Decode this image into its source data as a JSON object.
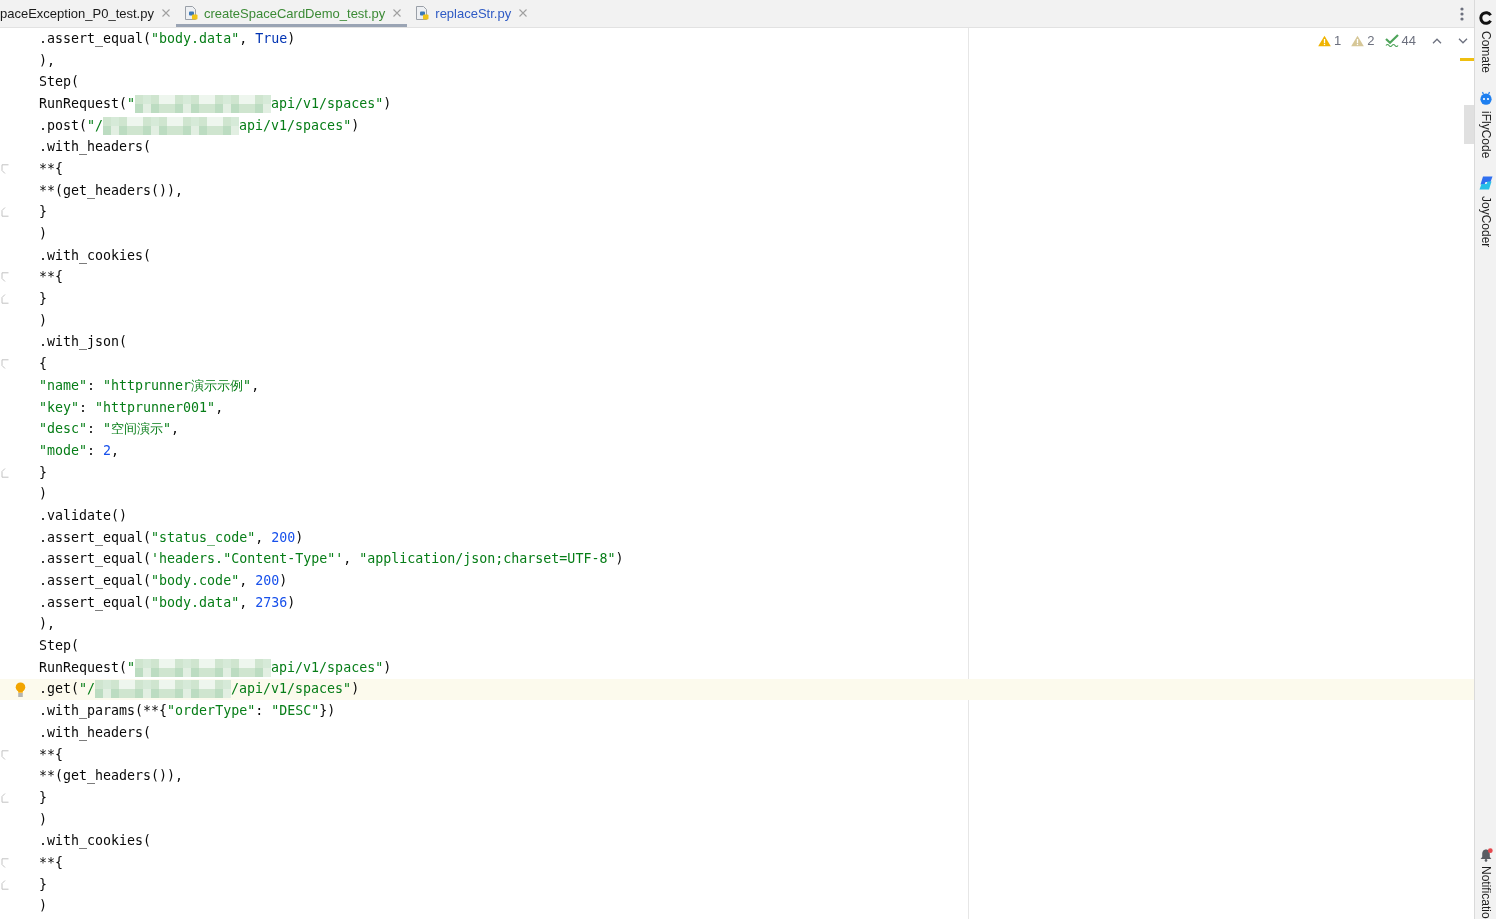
{
  "tabs": [
    {
      "label": "paceException_P0_test.py",
      "icon": false,
      "selected": false,
      "color": "#1a1a1a"
    },
    {
      "label": "createSpaceCardDemo_test.py",
      "icon": true,
      "selected": true,
      "color": "#3b8a35"
    },
    {
      "label": "replaceStr.py",
      "icon": true,
      "selected": false,
      "color": "#2e5ac4"
    }
  ],
  "editor": {
    "inspections": [
      {
        "kind": "warning",
        "count": "1"
      },
      {
        "kind": "weak_warning",
        "count": "2"
      },
      {
        "kind": "typo",
        "count": "44"
      }
    ],
    "code_lines": [
      {
        "current": false,
        "tokens": [
          {
            "kind": "plain",
            "text": "        .assert_equal("
          },
          {
            "kind": "string",
            "text": "\"body.data\""
          },
          {
            "kind": "plain",
            "text": ", "
          },
          {
            "kind": "keyword",
            "text": "True"
          },
          {
            "kind": "plain",
            "text": ")"
          }
        ]
      },
      {
        "current": false,
        "tokens": [
          {
            "kind": "plain",
            "text": "    ),"
          }
        ]
      },
      {
        "current": false,
        "tokens": [
          {
            "kind": "plain",
            "text": "    Step("
          }
        ]
      },
      {
        "current": false,
        "tokens": [
          {
            "kind": "plain",
            "text": "        RunRequest("
          },
          {
            "kind": "string",
            "text": "\""
          },
          {
            "kind": "redacted"
          },
          {
            "kind": "string",
            "text": "api/v1/spaces\""
          },
          {
            "kind": "plain",
            "text": ")"
          }
        ]
      },
      {
        "current": false,
        "tokens": [
          {
            "kind": "plain",
            "text": "        .post("
          },
          {
            "kind": "string",
            "text": "\"/"
          },
          {
            "kind": "redacted"
          },
          {
            "kind": "string",
            "text": "api/v1/spaces\""
          },
          {
            "kind": "plain",
            "text": ")"
          }
        ]
      },
      {
        "current": false,
        "tokens": [
          {
            "kind": "plain",
            "text": "        .with_headers("
          }
        ]
      },
      {
        "current": false,
        "fold_open": true,
        "tokens": [
          {
            "kind": "plain",
            "text": "            **{"
          }
        ]
      },
      {
        "current": false,
        "tokens": [
          {
            "kind": "plain",
            "text": "                **(get_headers()),"
          }
        ]
      },
      {
        "current": false,
        "fold_close": true,
        "tokens": [
          {
            "kind": "plain",
            "text": "            }"
          }
        ]
      },
      {
        "current": false,
        "tokens": [
          {
            "kind": "plain",
            "text": "        )"
          }
        ]
      },
      {
        "current": false,
        "tokens": [
          {
            "kind": "plain",
            "text": "        .with_cookies("
          }
        ]
      },
      {
        "current": false,
        "fold_open": true,
        "tokens": [
          {
            "kind": "plain",
            "text": "            **{"
          }
        ]
      },
      {
        "current": false,
        "fold_close": true,
        "tokens": [
          {
            "kind": "plain",
            "text": "            }"
          }
        ]
      },
      {
        "current": false,
        "tokens": [
          {
            "kind": "plain",
            "text": "        )"
          }
        ]
      },
      {
        "current": false,
        "tokens": [
          {
            "kind": "plain",
            "text": "        .with_json("
          }
        ]
      },
      {
        "current": false,
        "fold_open": true,
        "tokens": [
          {
            "kind": "plain",
            "text": "            {"
          }
        ]
      },
      {
        "current": false,
        "tokens": [
          {
            "kind": "string",
            "text": "                \"name\""
          },
          {
            "kind": "plain",
            "text": ": "
          },
          {
            "kind": "string",
            "text": "\"httprunner演示示例\""
          },
          {
            "kind": "plain",
            "text": ","
          }
        ]
      },
      {
        "current": false,
        "tokens": [
          {
            "kind": "string",
            "text": "                \"key\""
          },
          {
            "kind": "plain",
            "text": ": "
          },
          {
            "kind": "string",
            "text": "\"httprunner001\""
          },
          {
            "kind": "plain",
            "text": ","
          }
        ]
      },
      {
        "current": false,
        "tokens": [
          {
            "kind": "string",
            "text": "                \"desc\""
          },
          {
            "kind": "plain",
            "text": ": "
          },
          {
            "kind": "string",
            "text": "\"空间演示\""
          },
          {
            "kind": "plain",
            "text": ","
          }
        ]
      },
      {
        "current": false,
        "tokens": [
          {
            "kind": "string",
            "text": "                \"mode\""
          },
          {
            "kind": "plain",
            "text": ": "
          },
          {
            "kind": "number",
            "text": "2"
          },
          {
            "kind": "plain",
            "text": ","
          }
        ]
      },
      {
        "current": false,
        "fold_close": true,
        "tokens": [
          {
            "kind": "plain",
            "text": "            }"
          }
        ]
      },
      {
        "current": false,
        "tokens": [
          {
            "kind": "plain",
            "text": "        )"
          }
        ]
      },
      {
        "current": false,
        "tokens": [
          {
            "kind": "plain",
            "text": "        .validate()"
          }
        ]
      },
      {
        "current": false,
        "tokens": [
          {
            "kind": "plain",
            "text": "        .assert_equal("
          },
          {
            "kind": "string",
            "text": "\"status_code\""
          },
          {
            "kind": "plain",
            "text": ", "
          },
          {
            "kind": "number",
            "text": "200"
          },
          {
            "kind": "plain",
            "text": ")"
          }
        ]
      },
      {
        "current": false,
        "tokens": [
          {
            "kind": "plain",
            "text": "        .assert_equal("
          },
          {
            "kind": "string",
            "text": "'headers.\"Content-Type\"'"
          },
          {
            "kind": "plain",
            "text": ", "
          },
          {
            "kind": "string",
            "text": "\"application/json;charset=UTF-8\""
          },
          {
            "kind": "plain",
            "text": ")"
          }
        ]
      },
      {
        "current": false,
        "tokens": [
          {
            "kind": "plain",
            "text": "        .assert_equal("
          },
          {
            "kind": "string",
            "text": "\"body.code\""
          },
          {
            "kind": "plain",
            "text": ", "
          },
          {
            "kind": "number",
            "text": "200"
          },
          {
            "kind": "plain",
            "text": ")"
          }
        ]
      },
      {
        "current": false,
        "tokens": [
          {
            "kind": "plain",
            "text": "        .assert_equal("
          },
          {
            "kind": "string",
            "text": "\"body.data\""
          },
          {
            "kind": "plain",
            "text": ", "
          },
          {
            "kind": "number",
            "text": "2736"
          },
          {
            "kind": "plain",
            "text": ")"
          }
        ]
      },
      {
        "current": false,
        "tokens": [
          {
            "kind": "plain",
            "text": "    ),"
          }
        ]
      },
      {
        "current": false,
        "tokens": [
          {
            "kind": "plain",
            "text": "    Step("
          }
        ]
      },
      {
        "current": false,
        "tokens": [
          {
            "kind": "plain",
            "text": "        RunRequest("
          },
          {
            "kind": "string",
            "text": "\""
          },
          {
            "kind": "redacted"
          },
          {
            "kind": "string",
            "text": "api/v1/spaces\""
          },
          {
            "kind": "plain",
            "text": ")"
          }
        ]
      },
      {
        "current": true,
        "tokens": [
          {
            "kind": "plain",
            "text": "        .get("
          },
          {
            "kind": "string",
            "text": "\"/"
          },
          {
            "kind": "redacted"
          },
          {
            "kind": "string",
            "text": "/api/v1/spaces\""
          },
          {
            "kind": "plain",
            "text": ")"
          }
        ]
      },
      {
        "current": false,
        "tokens": [
          {
            "kind": "plain",
            "text": "        .with_params(**{"
          },
          {
            "kind": "string",
            "text": "\"orderType\""
          },
          {
            "kind": "plain",
            "text": ": "
          },
          {
            "kind": "string",
            "text": "\"DESC\""
          },
          {
            "kind": "plain",
            "text": "})"
          }
        ]
      },
      {
        "current": false,
        "tokens": [
          {
            "kind": "plain",
            "text": "        .with_headers("
          }
        ]
      },
      {
        "current": false,
        "fold_open": true,
        "tokens": [
          {
            "kind": "plain",
            "text": "            **{"
          }
        ]
      },
      {
        "current": false,
        "tokens": [
          {
            "kind": "plain",
            "text": "                **(get_headers()),"
          }
        ]
      },
      {
        "current": false,
        "fold_close": true,
        "tokens": [
          {
            "kind": "plain",
            "text": "            }"
          }
        ]
      },
      {
        "current": false,
        "tokens": [
          {
            "kind": "plain",
            "text": "        )"
          }
        ]
      },
      {
        "current": false,
        "tokens": [
          {
            "kind": "plain",
            "text": "        .with_cookies("
          }
        ]
      },
      {
        "current": false,
        "fold_open": true,
        "tokens": [
          {
            "kind": "plain",
            "text": "            **{"
          }
        ]
      },
      {
        "current": false,
        "fold_close": true,
        "tokens": [
          {
            "kind": "plain",
            "text": "            }"
          }
        ]
      },
      {
        "current": false,
        "tokens": [
          {
            "kind": "plain",
            "text": "        )"
          }
        ]
      }
    ]
  },
  "tool_window_bar": {
    "top": [
      {
        "kind": "ring",
        "label": "Comate",
        "alert": false
      },
      {
        "kind": "robot",
        "label": "iFlyCode",
        "alert": false
      },
      {
        "kind": "swirl",
        "label": "JoyCoder",
        "alert": false
      }
    ],
    "bottom": [
      {
        "kind": "bell",
        "label": "Notificatio",
        "alert": true
      }
    ]
  }
}
